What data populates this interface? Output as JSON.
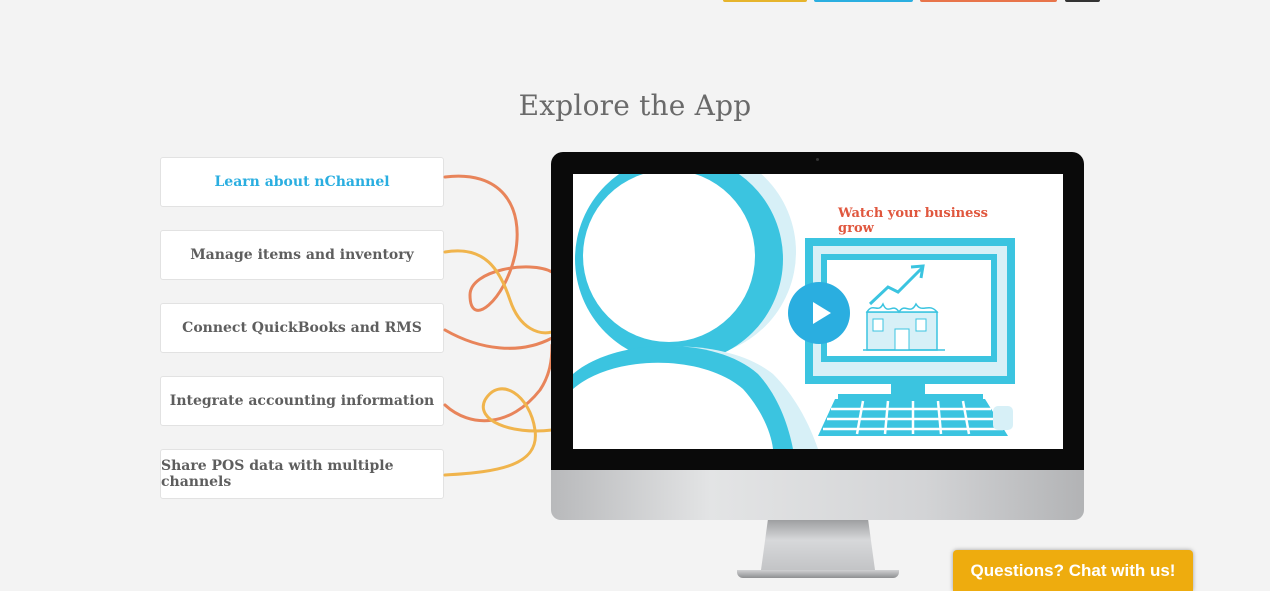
{
  "section": {
    "title": "Explore the App"
  },
  "features": [
    {
      "label": "Learn about nChannel",
      "active": true
    },
    {
      "label": "Manage items and inventory",
      "active": false
    },
    {
      "label": "Connect QuickBooks and RMS",
      "active": false
    },
    {
      "label": "Integrate accounting information",
      "active": false
    },
    {
      "label": "Share POS data with multiple channels",
      "active": false
    }
  ],
  "video": {
    "caption": "Watch your business grow",
    "play_icon": "play-icon"
  },
  "chat": {
    "label": "Questions? Chat with us!"
  },
  "colors": {
    "accent_blue": "#2aaee0",
    "screen_cyan": "#3bc4e0",
    "caption_red": "#e0573e",
    "chat_yellow": "#eeac0e",
    "string_orange": "#e8845a",
    "string_yellow": "#f0b44c",
    "topbar": [
      "#e6b42c",
      "#2aaee0",
      "#e8744a",
      "#333333"
    ]
  }
}
